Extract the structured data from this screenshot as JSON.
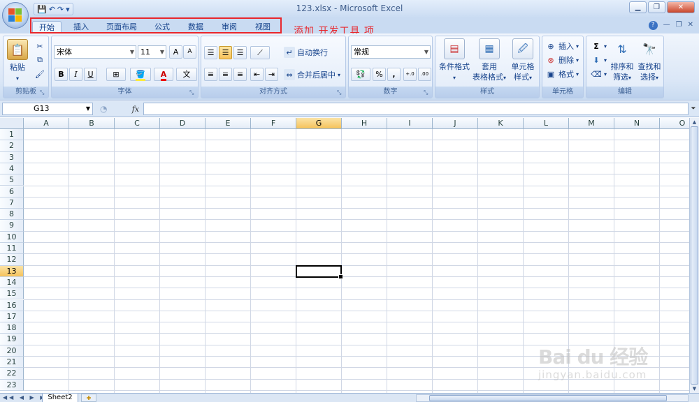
{
  "window": {
    "title": "123.xlsx - Microsoft Excel",
    "qat": [
      "💾",
      "↶",
      "↷",
      "▾"
    ]
  },
  "tabs": [
    "开始",
    "插入",
    "页面布局",
    "公式",
    "数据",
    "审阅",
    "视图"
  ],
  "active_tab": "开始",
  "annotation": "添加 开发工具 项",
  "ribbon": {
    "clipboard": {
      "paste": "粘贴",
      "label": "剪贴板"
    },
    "font": {
      "name": "宋体",
      "size": "11",
      "bold": "B",
      "italic": "I",
      "underline": "U",
      "grow": "A",
      "shrink": "A",
      "font_color": "A",
      "phonetic": "文",
      "label": "字体"
    },
    "alignment": {
      "wrap": "自动换行",
      "merge": "合并后居中",
      "label": "对齐方式"
    },
    "number": {
      "format": "常规",
      "percent": "%",
      "comma": ",",
      "inc_dec": "+.0",
      "dec_dec": ".00",
      "label": "数字"
    },
    "styles": {
      "conditional": "条件格式",
      "table_fmt_1": "套用",
      "table_fmt_2": "表格格式",
      "cell_styles_1": "单元格",
      "cell_styles_2": "样式",
      "label": "样式"
    },
    "cells": {
      "insert": "插入",
      "delete": "删除",
      "format": "格式",
      "label": "单元格"
    },
    "editing": {
      "sum": "Σ",
      "sort_1": "排序和",
      "sort_2": "筛选",
      "find_1": "查找和",
      "find_2": "选择",
      "label": "编辑"
    }
  },
  "formula_bar": {
    "name_box": "G13",
    "fx": "fx",
    "formula": ""
  },
  "grid": {
    "columns": [
      "A",
      "B",
      "C",
      "D",
      "E",
      "F",
      "G",
      "H",
      "I",
      "J",
      "K",
      "L",
      "M",
      "N",
      "O"
    ],
    "rows": [
      "1",
      "2",
      "3",
      "4",
      "5",
      "6",
      "7",
      "8",
      "9",
      "10",
      "11",
      "12",
      "13",
      "14",
      "15",
      "16",
      "17",
      "18",
      "19",
      "20",
      "21",
      "22",
      "23"
    ],
    "active_column": "G",
    "active_row": "13"
  },
  "sheets": [
    "Sheet2"
  ],
  "watermark": {
    "main": "Bai du 经验",
    "sub": "jingyan.baidu.com"
  }
}
